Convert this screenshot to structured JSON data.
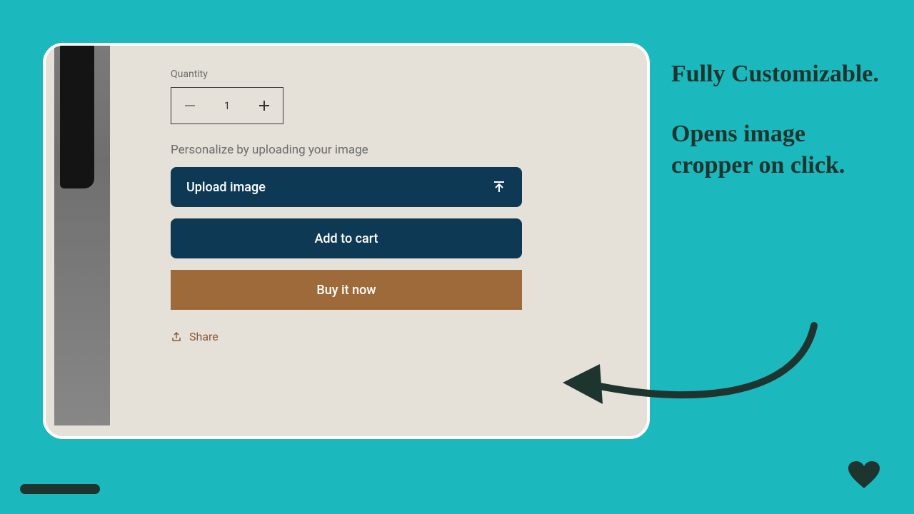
{
  "form": {
    "quantity_label": "Quantity",
    "quantity_value": "1",
    "personalize_label": "Personalize by uploading your image",
    "upload_button": "Upload image",
    "add_to_cart": "Add to cart",
    "buy_now": "Buy it now",
    "share": "Share"
  },
  "callout": {
    "line1": "Fully Customizable.",
    "line2": "Opens image cropper on click."
  },
  "colors": {
    "page_bg": "#1bb9bd",
    "card_bg": "#e5e1d9",
    "primary_btn": "#0e3954",
    "buy_btn": "#9e6a3a",
    "ink": "#1e342f"
  }
}
